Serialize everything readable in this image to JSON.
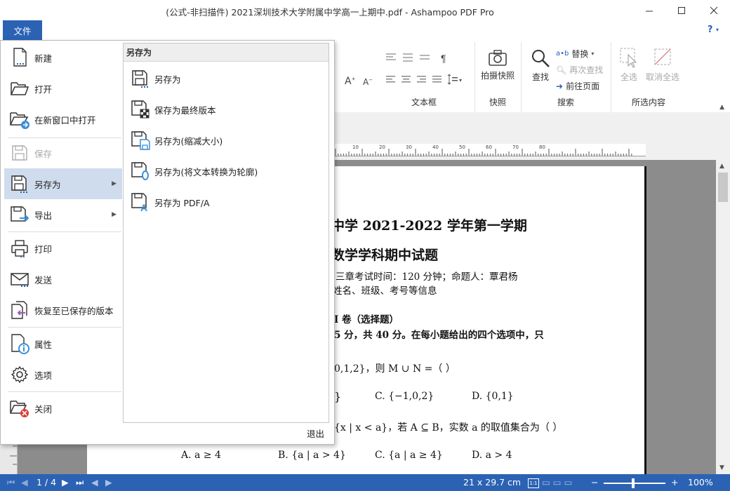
{
  "window": {
    "title": "(公式-非扫描件) 2021深圳技术大学附属中学高一上期中.pdf - Ashampoo PDF Pro"
  },
  "ribbon": {
    "file_tab": "文件",
    "help": "?",
    "groups": {
      "textbox": "文本框",
      "snapshot": "快照",
      "search": "搜索",
      "select": "所选内容"
    },
    "buttons": {
      "take_snapshot": "拍摄快照",
      "find": "查找",
      "replace": "替换",
      "find_again": "再次查找",
      "goto_page": "前往页面",
      "select_all": "全选",
      "deselect_all": "取消全选",
      "grow_font": "A",
      "shrink_font": "A"
    }
  },
  "ruler": {
    "numbers": [
      "10",
      "20",
      "30",
      "40",
      "50",
      "60",
      "70",
      "80"
    ]
  },
  "file_menu": {
    "items": [
      {
        "label": "新建"
      },
      {
        "label": "打开"
      },
      {
        "label": "在新窗口中打开"
      },
      {
        "label": "保存"
      },
      {
        "label": "另存为"
      },
      {
        "label": "导出"
      },
      {
        "label": "打印"
      },
      {
        "label": "发送"
      },
      {
        "label": "恢复至已保存的版本"
      },
      {
        "label": "属性"
      },
      {
        "label": "选项"
      },
      {
        "label": "关闭"
      }
    ],
    "exit": "退出",
    "submenu": {
      "title": "另存为",
      "items": [
        {
          "label": "另存为"
        },
        {
          "label": "保存为最终版本"
        },
        {
          "label": "另存为(缩减大小)"
        },
        {
          "label": "另存为(将文本转换为轮廓)"
        },
        {
          "label": "另存为 PDF/A"
        }
      ]
    }
  },
  "document": {
    "line1": "中学 2021-2022 学年第一学期",
    "line2": "数学学科期中试题",
    "line3": "三章考试时间：120 分钟；命题人：覃君杨",
    "line4": "姓名、班级、考号等信息",
    "line5": "I 卷（选择题）",
    "line6": "5 分，共 40 分。在每小题给出的四个选项中，只",
    "q1_stem": "0,1,2}，则 M ∪ N =（ ）",
    "q1_b_end": "}",
    "q1_c": "C.  {−1,0,2}",
    "q1_d": "D.  {0,1}",
    "q2_stem": "{x | x < a}，若 A ⊆ B，实数 a 的取值集合为（     ）",
    "q2_a": "A.  a ≥ 4",
    "q2_b": "B.  {a | a > 4}",
    "q2_c": "C.  {a | a ≥ 4}",
    "q2_d": "D.  a > 4"
  },
  "status": {
    "page_indicator": "1 / 4",
    "page_size": "21 x 29.7 cm",
    "zoom": "100%"
  },
  "colors": {
    "accent": "#2b62b4",
    "menu_active": "#cfdcee",
    "icon_blue": "#3a8fd8",
    "icon_red": "#e03a3a"
  }
}
